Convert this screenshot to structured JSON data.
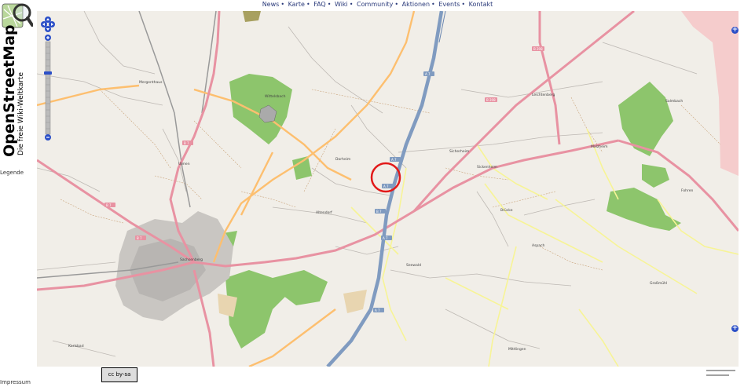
{
  "nav": {
    "items": [
      "News",
      "Karte",
      "FAQ",
      "Wiki",
      "Community",
      "Aktionen",
      "Events",
      "Kontakt"
    ]
  },
  "sidebar": {
    "title": "OpenStreetMap",
    "subtitle": "Die freie Wiki-Weltkarte",
    "legend_label": "Legende",
    "impressum": "Impressum"
  },
  "map": {
    "colors": {
      "background": "#f1eee8",
      "forest": "#8dc56c",
      "motorway": "#809bc0",
      "primary": "#e892a2",
      "secondary": "#fdbf6f",
      "industrial": "#f5cccc",
      "highlight_circle": "#e21a1a"
    },
    "road_labels": [
      "A 7",
      "A 7",
      "A 7",
      "A 7",
      "B 7",
      "B 7",
      "B 7",
      "B 208",
      "B 208",
      "B 7",
      "A 7"
    ],
    "place_labels": [
      "Mergenthaus",
      "Dorheim",
      "Sicherheim",
      "Sickenheim",
      "Altendorf",
      "Seewald",
      "Karlsbad",
      "Mittlingen",
      "Brücke",
      "Leichtenberg",
      "Salmbach",
      "Malzheim",
      "Ulmen",
      "Sachsenberg",
      "Aspach",
      "Großmühl",
      "Wittelsbach",
      "Fohren"
    ]
  },
  "footer": {
    "license": "cc by-sa"
  }
}
